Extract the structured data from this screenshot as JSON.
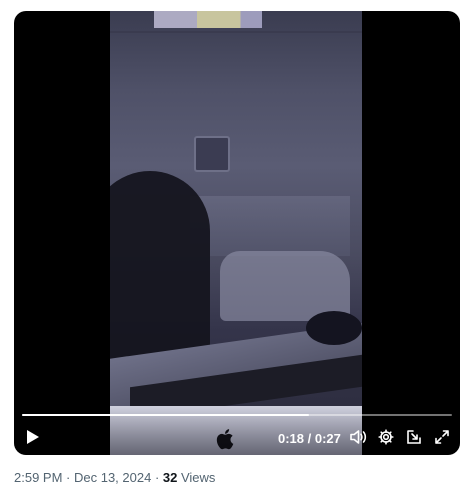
{
  "player": {
    "current_time": "0:18",
    "separator": " / ",
    "duration": "0:27",
    "progress_fraction": 0.667
  },
  "tweet_meta": {
    "time": "2:59 PM",
    "dot1": " · ",
    "date": "Dec 13, 2024",
    "dot2": " · ",
    "views_count": "32",
    "views_label": " Views"
  },
  "icons": {
    "play": "play-icon",
    "volume": "volume-icon",
    "settings": "gear-icon",
    "pip": "picture-in-picture-icon",
    "fullscreen": "fullscreen-icon"
  }
}
